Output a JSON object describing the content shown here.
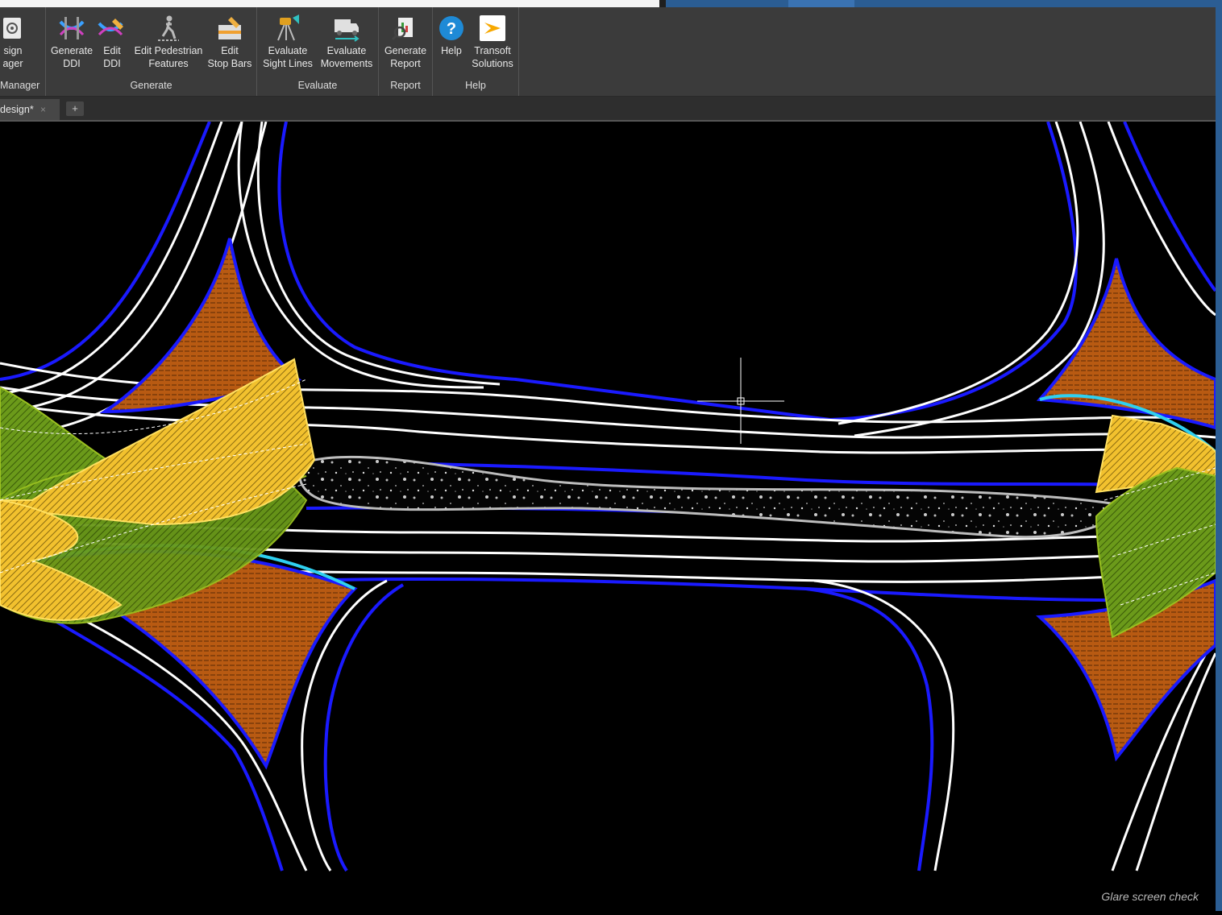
{
  "ribbon": {
    "panels": [
      {
        "title": "Manager",
        "tools": [
          {
            "label": "sign\nager",
            "icon": "design-manager-icon"
          }
        ]
      },
      {
        "title": "Generate",
        "tools": [
          {
            "label": "Generate\nDDI",
            "icon": "generate-ddi-icon"
          },
          {
            "label": "Edit\nDDI",
            "icon": "edit-ddi-icon"
          },
          {
            "label": "Edit Pedestrian\nFeatures",
            "icon": "pedestrian-icon"
          },
          {
            "label": "Edit\nStop Bars",
            "icon": "stop-bars-icon"
          }
        ]
      },
      {
        "title": "Evaluate",
        "tools": [
          {
            "label": "Evaluate\nSight Lines",
            "icon": "sight-lines-icon"
          },
          {
            "label": "Evaluate\nMovements",
            "icon": "truck-icon"
          }
        ]
      },
      {
        "title": "Report",
        "tools": [
          {
            "label": "Generate\nReport",
            "icon": "report-icon"
          }
        ]
      },
      {
        "title": "Help",
        "tools": [
          {
            "label": "Help",
            "icon": "help-icon"
          },
          {
            "label": "Transoft\nSolutions",
            "icon": "transoft-logo-icon"
          }
        ]
      }
    ]
  },
  "tabs": {
    "document": "design*",
    "close": "×",
    "add": "+"
  },
  "colors": {
    "road_edge": "#1a1aff",
    "lane_line": "#ffffff",
    "island_fill": "#b85a12",
    "sight_yellow": "#f2c12e",
    "sight_green": "#6b9a1a",
    "median": "#0a0a0a",
    "cyan_edge": "#2fd0f0"
  },
  "caption": "Glare screen check"
}
